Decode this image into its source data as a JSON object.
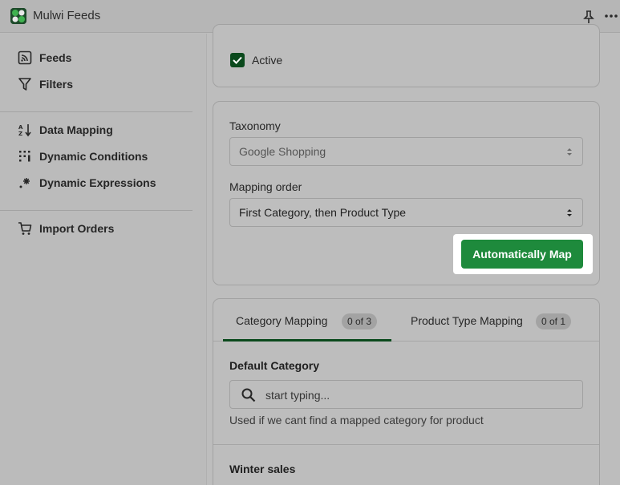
{
  "app": {
    "title": "Mulwi Feeds"
  },
  "sidebar": {
    "items": [
      {
        "label": "Feeds",
        "icon": "rss-icon"
      },
      {
        "label": "Filters",
        "icon": "filter-icon"
      },
      {
        "label": "Data Mapping",
        "icon": "sort-icon"
      },
      {
        "label": "Dynamic Conditions",
        "icon": "grid-dots-icon"
      },
      {
        "label": "Dynamic Expressions",
        "icon": "sparkle-icon"
      },
      {
        "label": "Import Orders",
        "icon": "cart-icon"
      }
    ]
  },
  "general": {
    "active_label": "Active",
    "active_checked": true
  },
  "taxonomy": {
    "label": "Taxonomy",
    "value": "Google Shopping",
    "mapping_order_label": "Mapping order",
    "mapping_order_value": "First Category, then Product Type",
    "auto_map_label": "Automatically Map"
  },
  "mapping": {
    "tabs": [
      {
        "label": "Category Mapping",
        "badge": "0 of 3"
      },
      {
        "label": "Product Type Mapping",
        "badge": "0 of 1"
      }
    ],
    "default_category_title": "Default Category",
    "search_placeholder": "start typing...",
    "hint": "Used if we cant find a mapped category for product",
    "next_section_title": "Winter sales"
  },
  "colors": {
    "accent": "#1e8a3c",
    "dark_green": "#0b4a1d"
  }
}
